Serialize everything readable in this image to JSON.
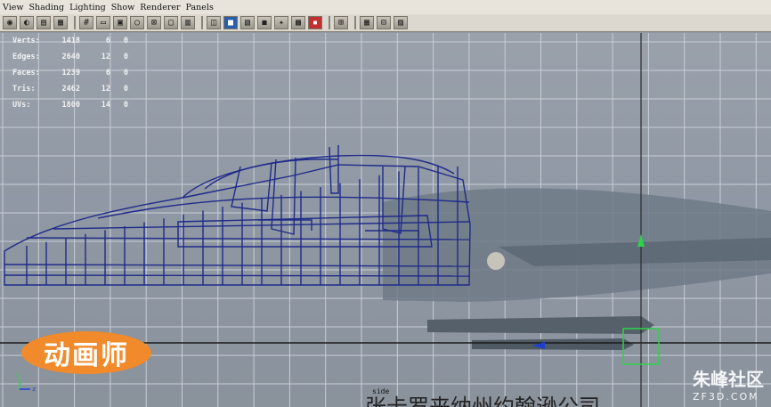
{
  "menu": [
    "View",
    "Shading",
    "Lighting",
    "Show",
    "Renderer",
    "Panels"
  ],
  "toolbar_icons": [
    "camera-icon",
    "camera-attr-icon",
    "bookmark-icon",
    "image-plane-icon",
    "grid-icon",
    "film-gate-icon",
    "resolution-gate-icon",
    "gate-mask-icon",
    "field-chart-icon",
    "safe-action-icon",
    "safe-title-icon",
    "wireframe-icon",
    "smooth-shade-icon",
    "bounding-box-icon",
    "flat-shade-icon",
    "use-lights-icon",
    "shadows-icon",
    "textured-icon",
    "x-ray-icon",
    "isolate-icon",
    "select-camera-icon",
    "ambient-occlusion-icon"
  ],
  "hud": {
    "rows": [
      {
        "label": "Verts:",
        "v1": "1418",
        "v2": "6",
        "v3": "0"
      },
      {
        "label": "Edges:",
        "v1": "2640",
        "v2": "12",
        "v3": "0"
      },
      {
        "label": "Faces:",
        "v1": "1239",
        "v2": "6",
        "v3": "0"
      },
      {
        "label": "Tris:",
        "v1": "2462",
        "v2": "12",
        "v3": "0"
      },
      {
        "label": "UVs:",
        "v1": "1800",
        "v2": "14",
        "v3": "0"
      }
    ]
  },
  "logo_text": "动画师",
  "watermark": {
    "big": "朱峰社区",
    "small": "ZF3D.COM"
  },
  "view_label": "side",
  "subtitle": "张卡罗来纳州约翰逊公司",
  "colors": {
    "wire": "#1f2a8a",
    "grid": "#c9ced6",
    "axis": "#ffffff",
    "accent": "#f08a2a"
  }
}
